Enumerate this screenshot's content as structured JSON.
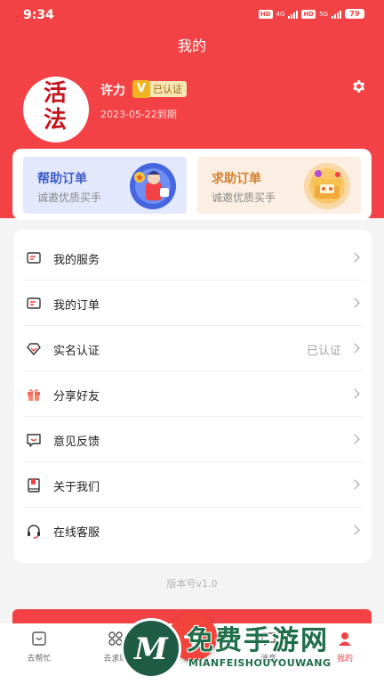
{
  "status_bar": {
    "time": "9:34",
    "hd1": "HD",
    "net1": "4G",
    "hd2": "HD",
    "net2": "5G",
    "battery": "79"
  },
  "header": {
    "title": "我的"
  },
  "profile": {
    "avatar_text": "活法",
    "name": "许力",
    "verified_badge": "已认证",
    "verified_icon_letter": "V",
    "expiry": "2023-05-22到期"
  },
  "cards": {
    "help": {
      "title": "帮助订单",
      "subtitle": "诚邀优质买手"
    },
    "seek": {
      "title": "求助订单",
      "subtitle": "诚邀优质买手"
    }
  },
  "menu": [
    {
      "label": "我的服务",
      "value": "",
      "icon": "service-icon"
    },
    {
      "label": "我的订单",
      "value": "",
      "icon": "order-icon"
    },
    {
      "label": "实名认证",
      "value": "已认证",
      "icon": "diamond-icon"
    },
    {
      "label": "分享好友",
      "value": "",
      "icon": "gift-icon"
    },
    {
      "label": "意见反馈",
      "value": "",
      "icon": "feedback-icon"
    },
    {
      "label": "关于我们",
      "value": "",
      "icon": "book-icon"
    },
    {
      "label": "在线客服",
      "value": "",
      "icon": "headset-icon"
    }
  ],
  "version": "版本号v1.0",
  "tabs": [
    {
      "label": "去帮忙",
      "icon": "help-tab-icon",
      "active": false
    },
    {
      "label": "去求助",
      "icon": "grid-tab-icon",
      "active": false
    },
    {
      "label": "发布",
      "icon": "plus-icon",
      "active": false
    },
    {
      "label": "消息",
      "icon": "message-tab-icon",
      "active": false
    },
    {
      "label": "我的",
      "icon": "profile-tab-icon",
      "active": true
    }
  ],
  "watermark": {
    "logo_letter": "M",
    "title": "免费手游网",
    "subtitle": "MIANFEISHOUYOUWANG"
  },
  "colors": {
    "primary": "#f24245",
    "help_accent": "#3e5dc8",
    "seek_accent": "#d5802c",
    "badge_bg": "#f7e6b3"
  }
}
